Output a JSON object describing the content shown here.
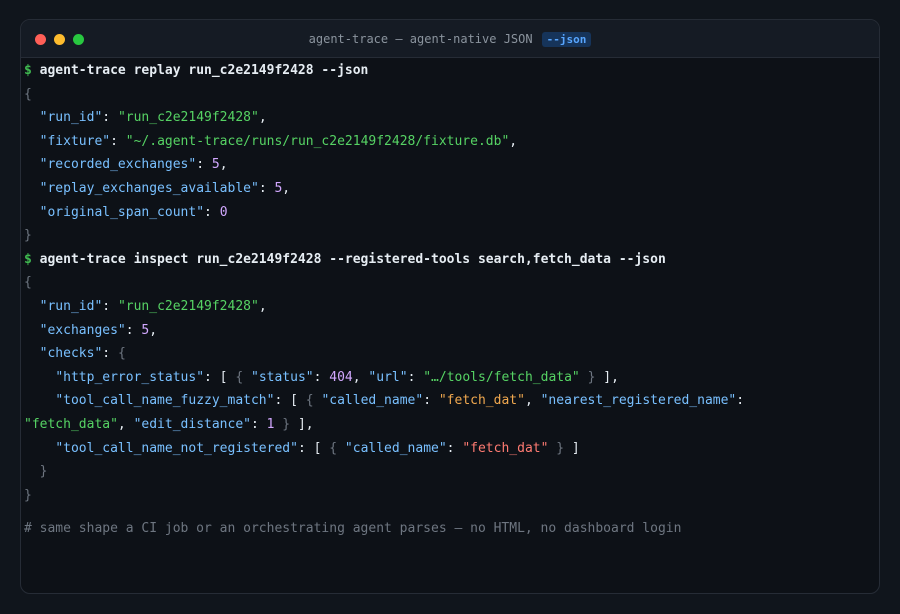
{
  "window": {
    "title": "agent-trace — agent-native JSON",
    "badge": "--json"
  },
  "colors": {
    "prompt": "#3fb950",
    "key": "#79c0ff",
    "string": "#56d364",
    "number": "#d2a8ff",
    "warning": "#f0a84f",
    "error": "#ff7b72",
    "badge_bg": "#16345a",
    "badge_fg": "#58a6ff"
  },
  "replay": {
    "prompt": "$",
    "command": "agent-trace replay run_c2e2149f2428 --json",
    "run_id_key": "\"run_id\"",
    "run_id_val": "\"run_c2e2149f2428\"",
    "fixture_key": "\"fixture\"",
    "fixture_val": "\"~/.agent-trace/runs/run_c2e2149f2428/fixture.db\"",
    "recorded_key": "\"recorded_exchanges\"",
    "recorded_val": "5",
    "replay_avail_key": "\"replay_exchanges_available\"",
    "replay_avail_val": "5",
    "span_count_key": "\"original_span_count\"",
    "span_count_val": "0"
  },
  "inspect": {
    "prompt": "$",
    "command": "agent-trace inspect run_c2e2149f2428 --registered-tools search,fetch_data --json",
    "run_id_key": "\"run_id\"",
    "run_id_val": "\"run_c2e2149f2428\"",
    "exchanges_key": "\"exchanges\"",
    "exchanges_val": "5",
    "checks_key": "\"checks\"",
    "http_key": "\"http_error_status\"",
    "status_key": "\"status\"",
    "status_val": "404",
    "url_key": "\"url\"",
    "url_val": "\"…/tools/fetch_data\"",
    "fuzzy_key": "\"tool_call_name_fuzzy_match\"",
    "called_name_key": "\"called_name\"",
    "called_name_val": "\"fetch_dat\"",
    "nearest_key": "\"nearest_registered_name\"",
    "nearest_val": "\"fetch_data\"",
    "edit_key": "\"edit_distance\"",
    "edit_val": "1",
    "not_reg_key": "\"tool_call_name_not_registered\"",
    "not_reg_called_key": "\"called_name\"",
    "not_reg_called_val": "\"fetch_dat\""
  },
  "comment": "# same shape a CI job or an orchestrating agent parses — no HTML, no dashboard login"
}
